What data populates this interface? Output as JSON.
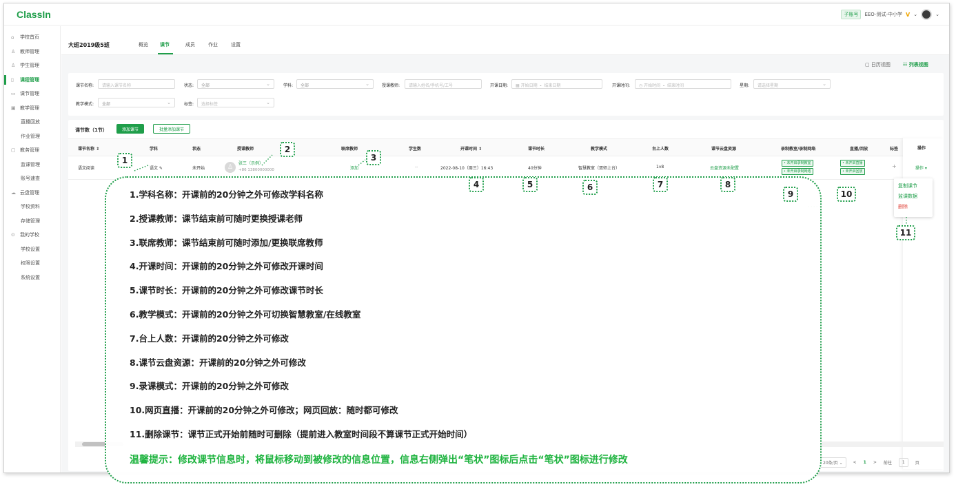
{
  "app": {
    "logo": "ClassIn",
    "sub_account_badge": "子账号",
    "org_name": "EEO-测试-中小学",
    "vip_mark": "V"
  },
  "sidebar": {
    "items": [
      {
        "label": "学校首页",
        "icon": "home-icon",
        "glyph": "⌂"
      },
      {
        "label": "教师管理",
        "icon": "user-icon",
        "glyph": "♙"
      },
      {
        "label": "学生管理",
        "icon": "user-icon",
        "glyph": "♙"
      },
      {
        "label": "课程管理",
        "icon": "course-icon",
        "glyph": "▯",
        "active": true
      },
      {
        "label": "课节管理",
        "icon": "lesson-icon",
        "glyph": "▭"
      },
      {
        "label": "教学管理",
        "icon": "teaching-icon",
        "glyph": "▣"
      },
      {
        "label": "直播回放",
        "sub": true
      },
      {
        "label": "作业管理",
        "sub": true
      },
      {
        "label": "教务管理",
        "icon": "affairs-icon",
        "glyph": "▢"
      },
      {
        "label": "监课管理",
        "sub": true
      },
      {
        "label": "账号速查",
        "sub": true
      },
      {
        "label": "云盘管理",
        "icon": "cloud-icon",
        "glyph": "☁"
      },
      {
        "label": "学校资料",
        "sub": true
      },
      {
        "label": "存储管理",
        "sub": true
      },
      {
        "label": "我的学校",
        "icon": "school-icon",
        "glyph": "⊙"
      },
      {
        "label": "学校设置",
        "sub": true
      },
      {
        "label": "权限设置",
        "sub": true
      },
      {
        "label": "系统设置",
        "sub": true
      }
    ]
  },
  "header": {
    "class_title": "大班2019级5班",
    "tabs": [
      "概览",
      "课节",
      "成员",
      "作业",
      "设置"
    ],
    "active_tab": "课节",
    "calendar_view": "日历视图",
    "list_view": "列表视图"
  },
  "filters": {
    "lesson_name_label": "课节名称:",
    "lesson_name_placeholder": "请输入课节名称",
    "status_label": "状态:",
    "status_value": "全部",
    "subject_label": "学科:",
    "subject_value": "全部",
    "teacher_label": "授课教师:",
    "teacher_placeholder": "请输入姓名/手机号/工号",
    "start_date_label": "开课日期:",
    "start_date_placeholder": "开始日期",
    "end_date_placeholder": "结束日期",
    "start_time_label": "开课时间:",
    "start_time_placeholder": "开始时间",
    "end_time_placeholder": "结束时间",
    "weekday_label": "星期:",
    "weekday_placeholder": "请选择星期",
    "mode_label": "教学模式:",
    "mode_value": "全部",
    "tag_label": "标签:",
    "tag_placeholder": "选择标签",
    "range_sep": "-"
  },
  "table": {
    "count_label": "课节数（1节）",
    "add_button": "添加课节",
    "batch_add_button": "批量添加课节",
    "headers": [
      "课节名称 ⇕",
      "学科",
      "状态",
      "授课教师",
      "联席教师",
      "学生数",
      "开课时间 ⇕",
      "课节时长",
      "教学模式",
      "台上人数",
      "课节云盘资源",
      "录制教室/录制网络",
      "直播/回放",
      "标签",
      "操作"
    ],
    "row": {
      "name": "语文阅读",
      "subject": "语文 ✎",
      "status": "未开始",
      "teacher_name": "张三（示例）",
      "teacher_phone": "+86 13800000000",
      "co_teacher": "添加",
      "students": "--",
      "start_time": "2022-08-10（周三）16:43",
      "duration": "40分钟",
      "mode": "智慧教室（双师上台）",
      "stage_count": "1v8",
      "cloud_res": "云盘资源未配置",
      "record_1": "• 未开启录制教室",
      "record_2": "• 未开启录制网络",
      "live_1": "• 未开启直播",
      "live_2": "• 未开启回放",
      "tag": "+",
      "op": "操作 ▾"
    }
  },
  "dropdown": {
    "items": [
      "复制课节",
      "监课数据",
      "删除"
    ]
  },
  "pagination": {
    "page_size": "20条/页",
    "prev": "<",
    "current": "1",
    "next": ">",
    "goto_label": "前往",
    "goto_value": "1",
    "page_unit": "页"
  },
  "markers": [
    "1",
    "2",
    "3",
    "4",
    "5",
    "6",
    "7",
    "8",
    "9",
    "10",
    "11"
  ],
  "callout": {
    "lines": [
      "1.学科名称：开课前的20分钟之外可修改学科名称",
      "2.授课教师：课节结束前可随时更换授课老师",
      "3.联席教师：课节结束前可随时添加/更换联席教师",
      "4.开课时间：开课前的20分钟之外可修改开课时间",
      "5.课节时长：开课前的20分钟之外可修改课节时长",
      "6.教学模式：开课前的20分钟之外可切换智慧教室/在线教室",
      "7.台上人数：开课前的20分钟之外可修改",
      "8.课节云盘资源：开课前的20分钟之外可修改",
      "9.录课模式：开课前的20分钟之外可修改",
      "10.网页直播：开课前的20分钟之外可修改；网页回放：随时都可修改",
      "11.删除课节：课节正式开始前随时可删除（提前进入教室时间段不算课节正式开始时间）"
    ],
    "tip": "温馨提示：修改课节信息时，将鼠标移动到被修改的信息位置，信息右侧弹出“笔状”图标后点击“笔状”图标进行修改"
  },
  "colors": {
    "brand": "#1f9e4a",
    "tip_green": "#1eb33f",
    "danger": "#e0463d"
  }
}
